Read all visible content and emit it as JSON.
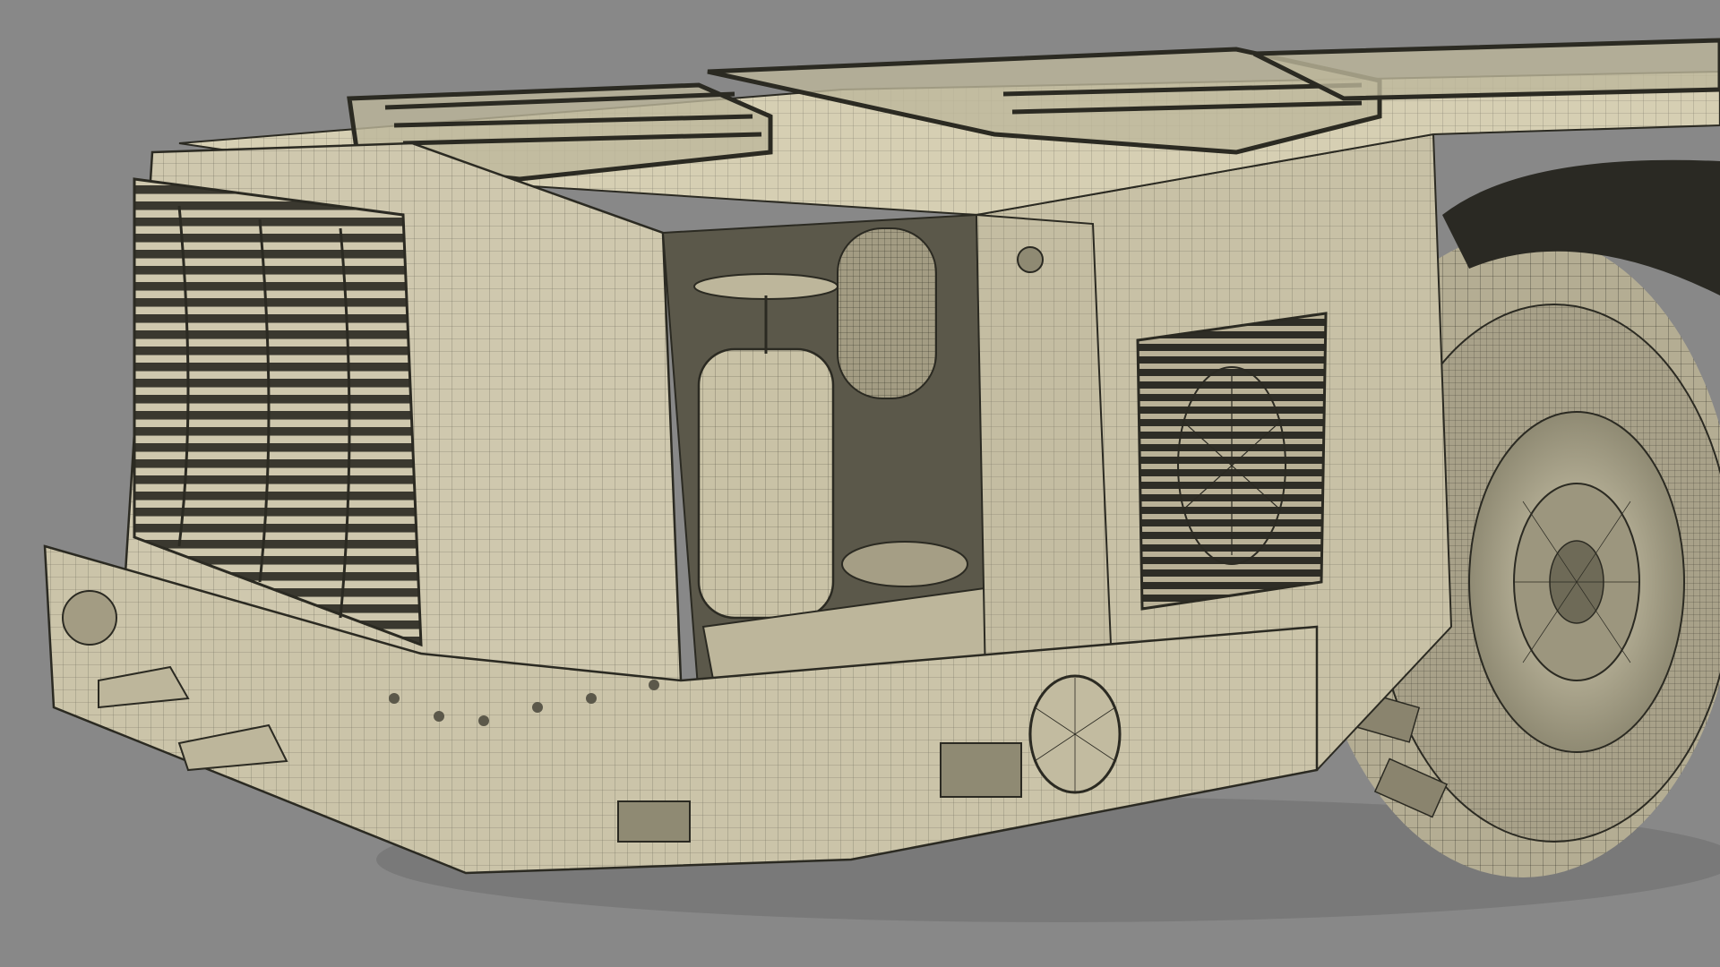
{
  "scene": {
    "subject": "wireframe-render-underground-loader-rear",
    "colors": {
      "background": "#888888",
      "body": "#cfc8ae",
      "body_shade": "#b9b197",
      "body_dark": "#8f8a73",
      "wire": "#2b2a22",
      "tire": "#b4ad93",
      "tire_shade": "#8a846e",
      "shadow": "#3a382f"
    }
  }
}
